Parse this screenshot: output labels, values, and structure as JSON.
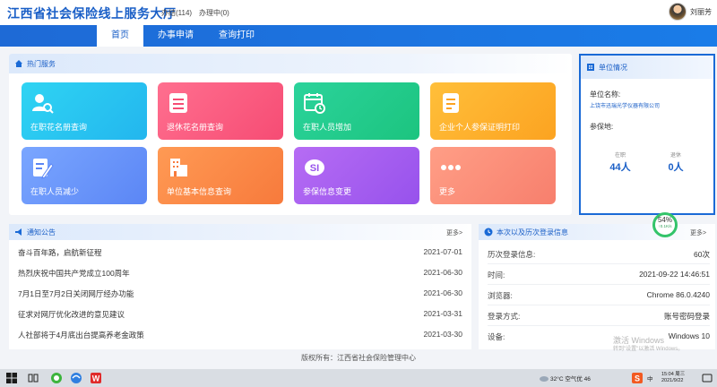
{
  "header": {
    "site_title": "江西省社会保险线上服务大厅",
    "todo_link": "办结(114)",
    "in_progress_link": "办理中(0)",
    "user_name": "刘丽芳"
  },
  "nav": {
    "tabs": [
      {
        "label": "首页",
        "active": true
      },
      {
        "label": "办事申请",
        "active": false
      },
      {
        "label": "查询打印",
        "active": false
      }
    ]
  },
  "hot_services": {
    "title": "热门服务",
    "tiles": [
      {
        "label": "在职花名册查询",
        "icon": "person-search-icon",
        "color": "#23b6ee"
      },
      {
        "label": "退休花名册查询",
        "icon": "list-icon",
        "color": "#f64c74"
      },
      {
        "label": "在职人员增加",
        "icon": "calendar-clock-icon",
        "color": "#1cc47f"
      },
      {
        "label": "企业个人参保证明打印",
        "icon": "document-icon",
        "color": "#fca321"
      },
      {
        "label": "在职人员减少",
        "icon": "edit-document-icon",
        "color": "#5b86f5"
      },
      {
        "label": "单位基本信息查询",
        "icon": "building-icon",
        "color": "#f77a3c"
      },
      {
        "label": "参保信息变更",
        "icon": "social-insurance-icon",
        "color": "#9752ec"
      },
      {
        "label": "更多",
        "icon": "more-icon",
        "color": "#f77f6d"
      }
    ]
  },
  "unit_info": {
    "title": "单位情况",
    "name_label": "单位名称:",
    "name_value": "上饶市迅瑞光学仪器有限公司",
    "insured_label": "参保地:",
    "active_label": "在职",
    "active_value": "44人",
    "retired_label": "退休",
    "retired_value": "0人"
  },
  "notices": {
    "title": "通知公告",
    "more": "更多>",
    "items": [
      {
        "title": "奋斗百年路，启航新征程",
        "date": "2021-07-01"
      },
      {
        "title": "热烈庆祝中国共产党成立100周年",
        "date": "2021-06-30"
      },
      {
        "title": "7月1日至7月2日关闭网厅经办功能",
        "date": "2021-06-30"
      },
      {
        "title": "征求对网厅优化改进的意见建议",
        "date": "2021-03-31"
      },
      {
        "title": "人社部将于4月底出台提高养老金政策",
        "date": "2021-03-30"
      }
    ]
  },
  "login_info": {
    "title": "本次以及历次登录信息",
    "more": "更多>",
    "rows": [
      {
        "key": "历次登录信息:",
        "value": "60次"
      },
      {
        "key": "时间:",
        "value": "2021-09-22 14:46:51"
      },
      {
        "key": "浏览器:",
        "value": "Chrome 86.0.4240"
      },
      {
        "key": "登录方式:",
        "value": "账号密码登录"
      },
      {
        "key": "设备:",
        "value": "Windows 10"
      }
    ]
  },
  "gauge": {
    "percent": "54%",
    "speed": "↑0.1K/s"
  },
  "watermark": {
    "line1": "激活 Windows",
    "line2": "转到\"设置\"以激活 Windows。"
  },
  "footer": {
    "text": "版权所有：江西省社会保险管理中心"
  },
  "taskbar": {
    "weather": "32°C 空气优 46",
    "time": "15:04 周三",
    "date": "2021/9/22",
    "language": "中"
  }
}
